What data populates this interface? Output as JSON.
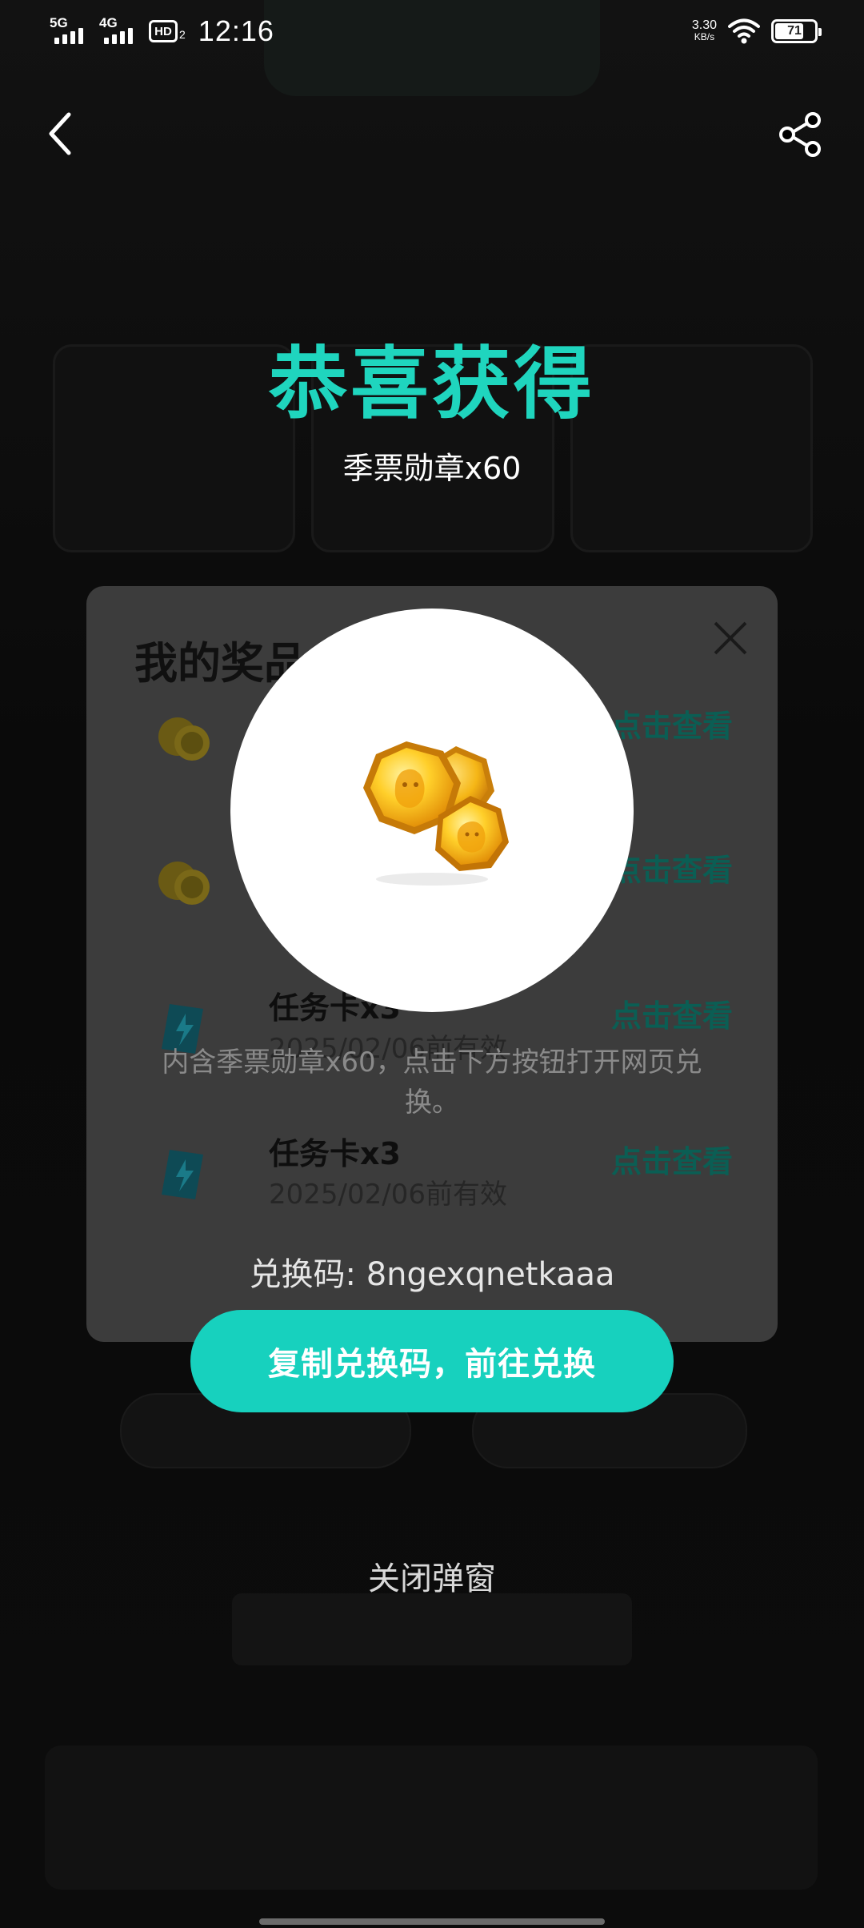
{
  "status_bar": {
    "network1": "5G",
    "network2": "4G",
    "hd_label": "HD",
    "hd_sub": "2",
    "time": "12:16",
    "speed_value": "3.30",
    "speed_unit": "KB/s",
    "battery": "71"
  },
  "congrats": {
    "title": "恭喜获得",
    "reward": "季票勋章x60",
    "description": "内含季票勋章x60，点击下方按钮打开网页兑换。",
    "code_text": "兑换码: 8ngexqnetkaaa",
    "copy_button": "复制兑换码，前往兑换",
    "close_button": "关闭弹窗"
  },
  "background_dialog": {
    "title": "我的奖品",
    "items": [
      {
        "name": "",
        "date": "",
        "view": "点击查看",
        "icon": "coin-icon"
      },
      {
        "name": "",
        "date": "",
        "view": "点击查看",
        "icon": "coin-icon"
      },
      {
        "name": "任务卡x3",
        "date": "2025/02/06前有效",
        "view": "点击查看",
        "icon": "task-card-icon"
      },
      {
        "name": "任务卡x3",
        "date": "2025/02/06前有效",
        "view": "点击查看",
        "icon": "task-card-icon"
      }
    ]
  },
  "colors": {
    "accent": "#1fd5be",
    "button": "#17d1be"
  }
}
